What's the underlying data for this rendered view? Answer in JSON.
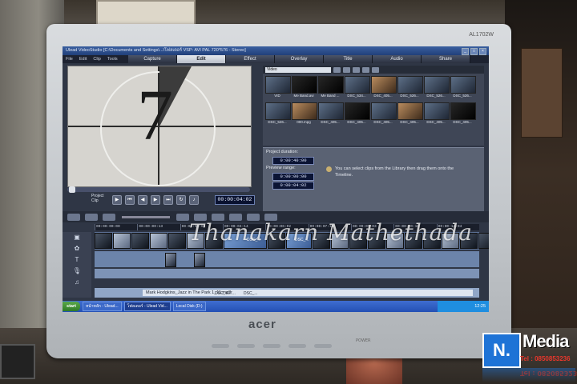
{
  "monitor": {
    "model": "AL1702W",
    "brand": "acer",
    "power_label": "POWER"
  },
  "app": {
    "title": "Ulead VideoStudio [C:\\Documents and Settings\\...\\โฟลเดอร์ VSP: AVI PAL 720*576 - Stereo]",
    "menu": [
      "File",
      "Edit",
      "Clip",
      "Tools"
    ],
    "steps": [
      "Capture",
      "Edit",
      "Effect",
      "Overlay",
      "Title",
      "Audio",
      "Share"
    ],
    "active_step": "Edit"
  },
  "preview": {
    "countdown_digit": "7",
    "mode_labels": [
      "Project",
      "Clip"
    ],
    "timecode": "00:00:04:02"
  },
  "library": {
    "category": "Video",
    "items": [
      "VID",
      "Me Band.avi",
      "Me Band ...",
      "DSC_534...",
      "DSC_405...",
      "DSC_526...",
      "DSC_526...",
      "DSC_526...",
      "DSC_526...",
      "000.mpg",
      "DSC_405...",
      "DSC_405...",
      "DSC_405...",
      "DSC_405...",
      "DSC_405...",
      "DSC_405..."
    ]
  },
  "options": {
    "project_duration_label": "Project duration:",
    "project_duration": "0:00:40:00",
    "preview_range_label": "Preview range:",
    "preview_start": "0:00:00:00",
    "preview_end": "0:00:04:02",
    "hint": "You can select clips from the Library then drag them onto the Timeline."
  },
  "watermark": "Thanakarn Mathethada",
  "timeline": {
    "ruler": [
      "00:00:00:00",
      "00:00:00:13",
      "00:00:03:03",
      "00:00:04:14",
      "00:00:06:02",
      "00:00:07:15",
      "00:00:09:03",
      "00:00:10:16",
      "00:00:12:04"
    ],
    "video_clip_labels": [
      "DSC_...",
      "DSC_..."
    ],
    "music_clip": "Mark Hodgkins_Jazz in The Park 1_11.mp3",
    "voice_clips": [
      "DSC_407...",
      "DSC_..."
    ]
  },
  "taskbar": {
    "start": "start",
    "items": [
      "หน้าหลัก - Ulead...",
      "โฟลเดอร์ - Ulead Vid...",
      "Local Disk (D:)"
    ],
    "clock": "12:25"
  },
  "logo": {
    "letter": "N.",
    "word": "Media",
    "tel1": "Tel : 0850853236",
    "tel2": "Tel : 0850853236"
  }
}
